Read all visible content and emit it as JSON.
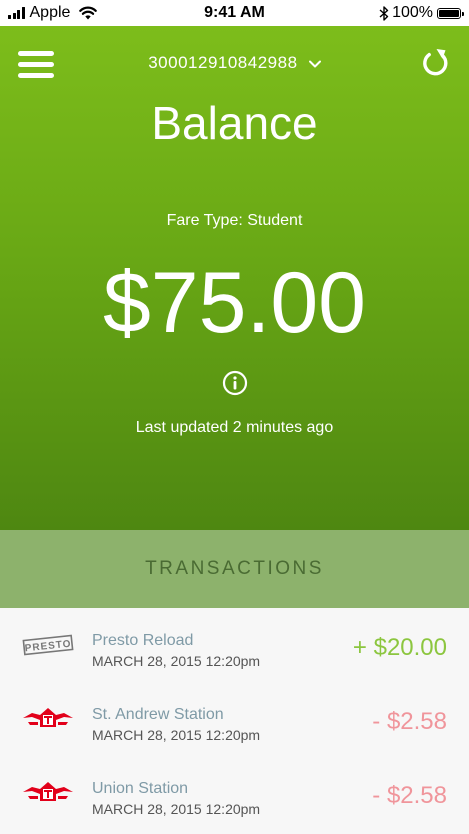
{
  "status_bar": {
    "carrier": "Apple",
    "time": "9:41 AM",
    "battery": "100%"
  },
  "header": {
    "account_number": "300012910842988",
    "title": "Balance",
    "fare_type": "Fare Type: Student",
    "balance": "$75.00",
    "last_updated": "Last updated 2 minutes ago"
  },
  "transactions": {
    "title": "TRANSACTIONS",
    "items": [
      {
        "name": "Presto Reload",
        "date": "MARCH 28, 2015 12:20pm",
        "amount": "+ $20.00",
        "logo": "presto-logo-icon",
        "type": "credit"
      },
      {
        "name": "St. Andrew Station",
        "date": "MARCH 28, 2015 12:20pm",
        "amount": "- $2.58",
        "logo": "ttc-logo-icon",
        "type": "debit"
      },
      {
        "name": "Union Station",
        "date": "MARCH 28, 2015 12:20pm",
        "amount": "- $2.58",
        "logo": "ttc-logo-icon",
        "type": "debit"
      }
    ]
  },
  "colors": {
    "brand_green": "#7dbd1b",
    "header_band": "#8db26c",
    "credit": "#8cc63f",
    "debit": "#f0959b",
    "ttc_red": "#e2001a"
  }
}
